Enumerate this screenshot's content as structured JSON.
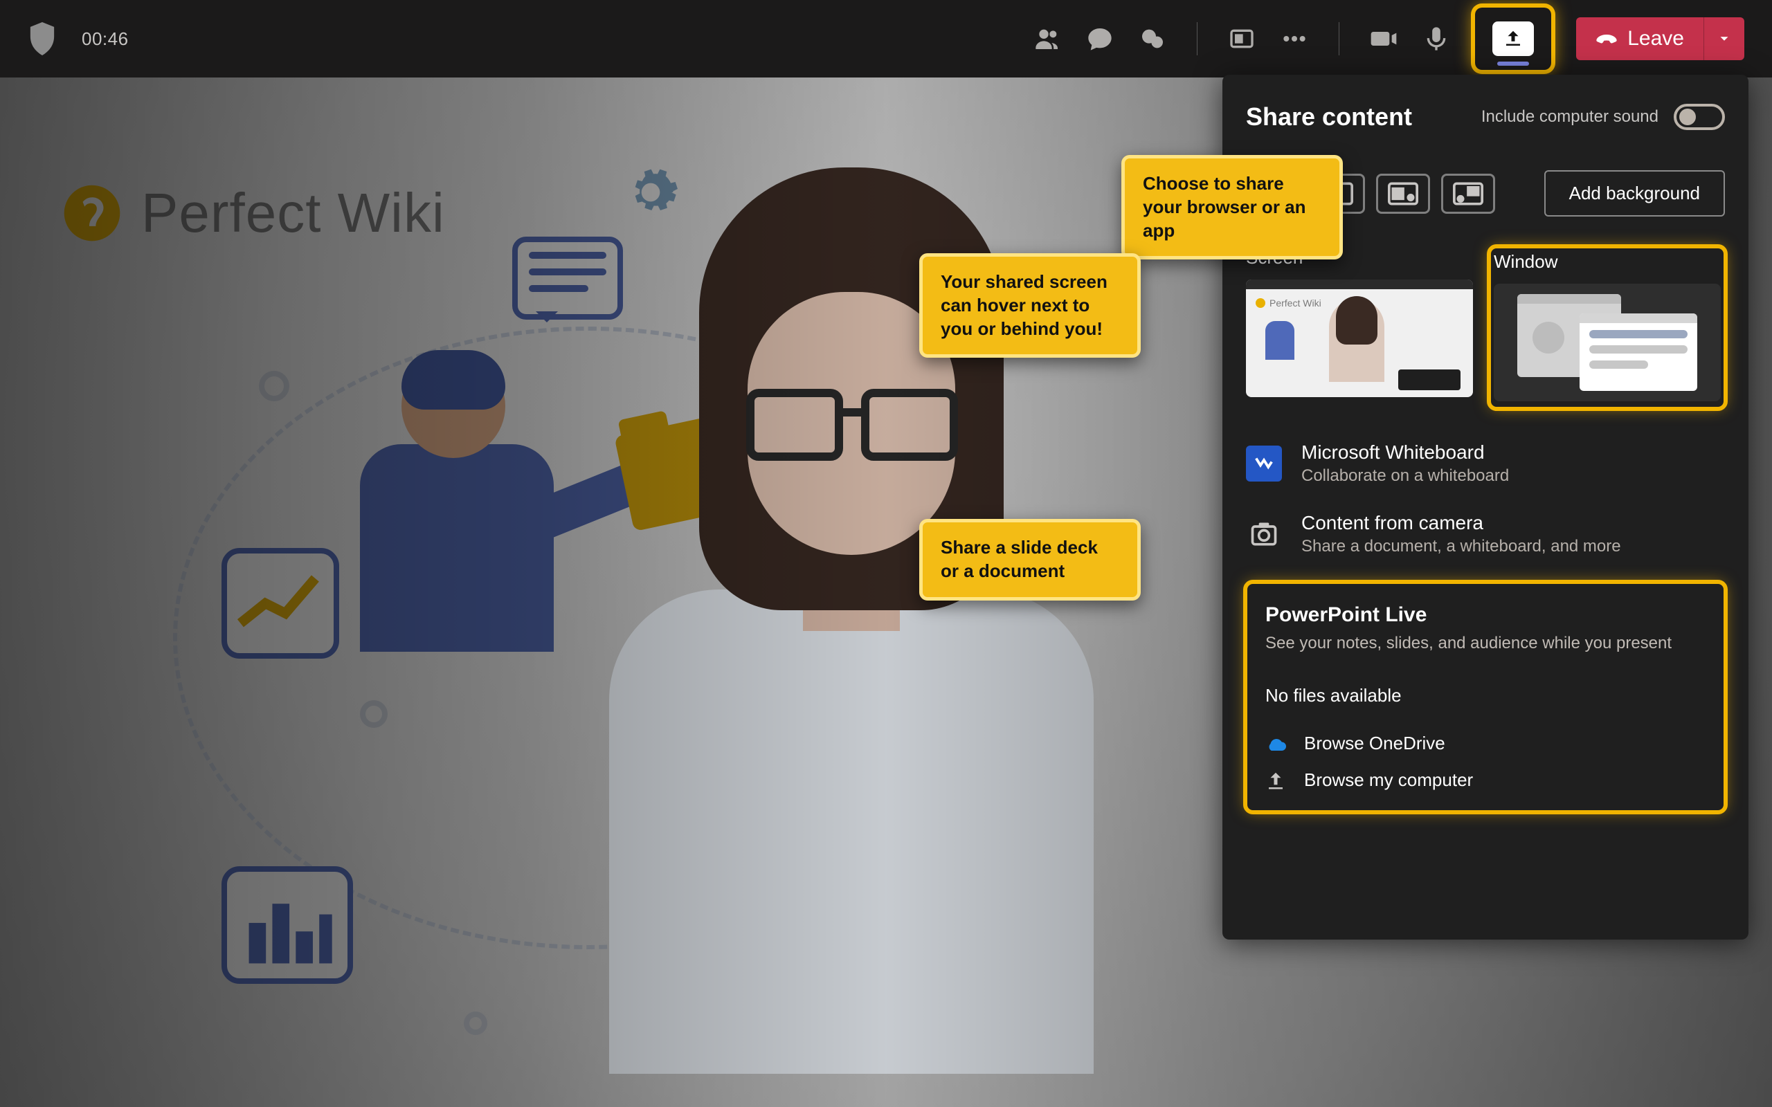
{
  "topbar": {
    "call_time": "00:46",
    "leave_label": "Leave"
  },
  "panel": {
    "title": "Share content",
    "include_sound": "Include computer sound",
    "add_background": "Add background",
    "screen_label": "Screen",
    "window_label": "Window",
    "whiteboard": {
      "title": "Microsoft Whiteboard",
      "sub": "Collaborate on a whiteboard"
    },
    "camera_content": {
      "title": "Content from camera",
      "sub": "Share a document, a whiteboard, and more"
    },
    "ppt": {
      "title": "PowerPoint Live",
      "sub": "See your notes, slides, and audience while you present",
      "no_files": "No files available",
      "browse_od": "Browse OneDrive",
      "browse_pc": "Browse my computer"
    }
  },
  "shared_app": {
    "brand": "Perfect Wiki"
  },
  "callouts": {
    "c1": "Choose to share your browser or an app",
    "c2": "Your shared screen can hover next to you or behind you!",
    "c3": "Share a slide deck or a document"
  }
}
